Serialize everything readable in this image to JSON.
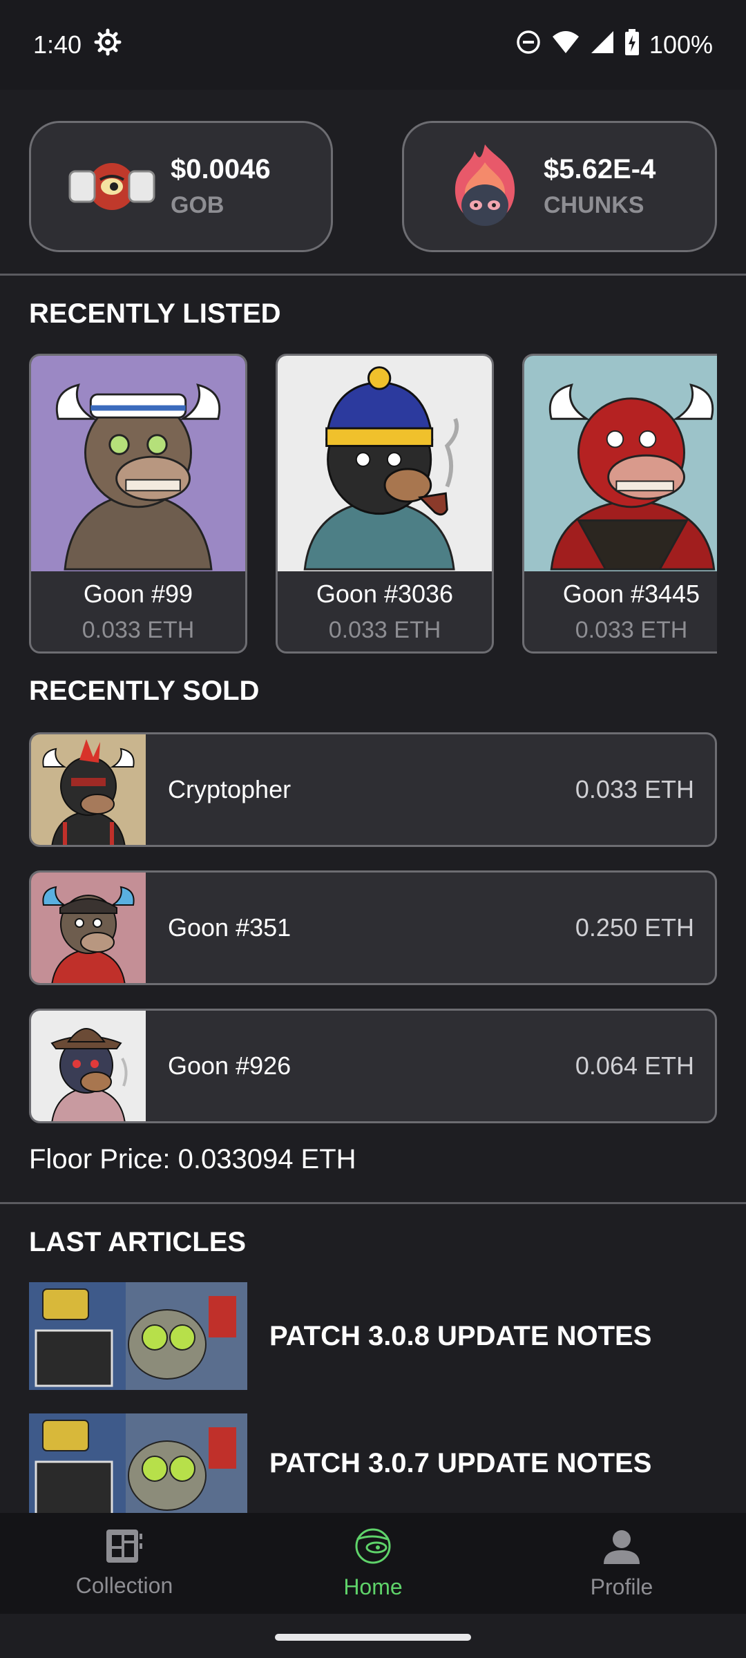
{
  "status_bar": {
    "time": "1:40",
    "battery": "100%",
    "icons": [
      "gear-icon",
      "do-not-disturb-icon",
      "wifi-icon",
      "signal-icon",
      "battery-charging-icon"
    ]
  },
  "tokens": [
    {
      "price": "$0.0046",
      "name": "GOB",
      "logo": "gob-logo"
    },
    {
      "price": "$5.62E-4",
      "name": "CHUNKS",
      "logo": "chunks-logo"
    }
  ],
  "recently_listed": {
    "title": "RECENTLY LISTED",
    "items": [
      {
        "name": "Goon #99",
        "price": "0.033 ETH",
        "bg": "#9b88c4"
      },
      {
        "name": "Goon #3036",
        "price": "0.033 ETH",
        "bg": "#ececec"
      },
      {
        "name": "Goon #3445",
        "price": "0.033 ETH",
        "bg": "#9cc3c9"
      }
    ]
  },
  "recently_sold": {
    "title": "RECENTLY SOLD",
    "items": [
      {
        "name": "Cryptopher",
        "price": "0.033 ETH",
        "bg": "#c9b58e"
      },
      {
        "name": "Goon #351",
        "price": "0.250 ETH",
        "bg": "#c48f96"
      },
      {
        "name": "Goon #926",
        "price": "0.064 ETH",
        "bg": "#ececec"
      }
    ]
  },
  "floor_price": "Floor Price: 0.033094 ETH",
  "articles": {
    "title": "LAST ARTICLES",
    "items": [
      {
        "title": "PATCH 3.0.8 UPDATE NOTES"
      },
      {
        "title": "PATCH 3.0.7 UPDATE NOTES"
      }
    ]
  },
  "nav": {
    "items": [
      {
        "label": "Collection",
        "icon": "collection-icon"
      },
      {
        "label": "Home",
        "icon": "home-goblin-icon"
      },
      {
        "label": "Profile",
        "icon": "profile-icon"
      }
    ],
    "active": "Home"
  },
  "colors": {
    "accent": "#5fd36a",
    "background": "#1e1e22",
    "card": "#2e2e33",
    "muted": "#8e8e93"
  }
}
